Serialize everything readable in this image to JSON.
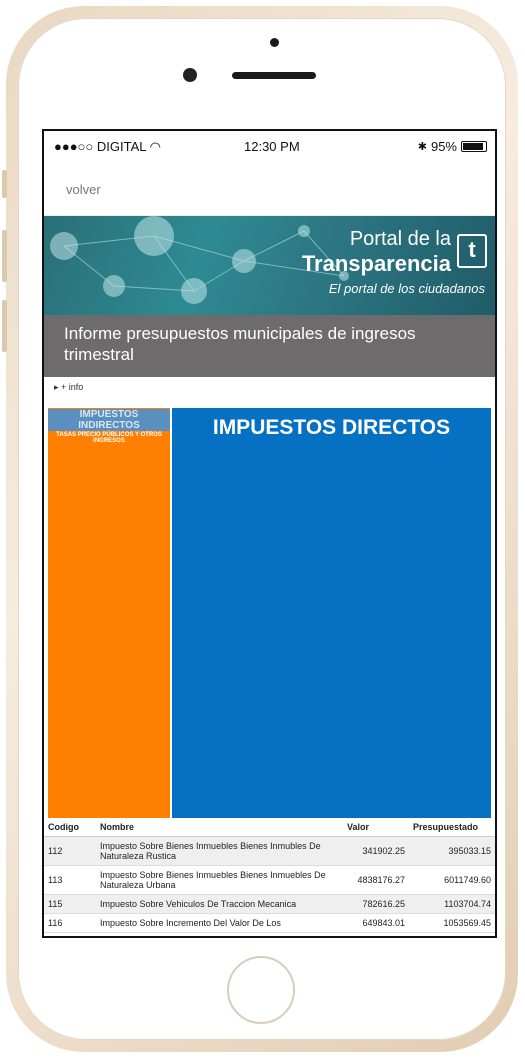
{
  "status_bar": {
    "carrier": "●●●○○ DIGITAL",
    "time": "12:30 PM",
    "battery": "95%"
  },
  "nav": {
    "back_label": "volver"
  },
  "banner": {
    "line1": "Portal de la",
    "line2": "Transparencia",
    "tagline": "El portal de los ciudadanos",
    "logo_letter": "t"
  },
  "page_title": "Informe presupuestos municipales de ingresos trimestral",
  "info_toggle": "▸ + info",
  "chart_data": {
    "type": "treemap",
    "tiles": [
      {
        "label": "IMPUESTOS INDIRECTOS",
        "sublabel": "TASAS PRECIO PÚBLICOS Y OTROS INGRESOS",
        "color": "#ff8000"
      },
      {
        "label": "IMPUESTOS DIRECTOS",
        "color": "#0670c2"
      }
    ]
  },
  "table": {
    "headers": [
      "Codigo",
      "Nombre",
      "Valor",
      "Presupuestado"
    ],
    "rows": [
      {
        "codigo": "112",
        "nombre": "Impuesto Sobre Bienes Inmuebles Bienes Inmubles De Naturaleza Rustica",
        "valor": "341902.25",
        "presupuestado": "395033.15"
      },
      {
        "codigo": "113",
        "nombre": "Impuesto Sobre Bienes Inmuebles Bienes Inmuebles De Naturaleza Urbana",
        "valor": "4838176.27",
        "presupuestado": "6011749.60"
      },
      {
        "codigo": "115",
        "nombre": "Impuesto Sobre Vehiculos De Traccion Mecanica",
        "valor": "782616.25",
        "presupuestado": "1103704.74"
      },
      {
        "codigo": "116",
        "nombre": "Impuesto Sobre Incremento Del Valor De Los",
        "valor": "649843.01",
        "presupuestado": "1053569.45"
      }
    ]
  }
}
